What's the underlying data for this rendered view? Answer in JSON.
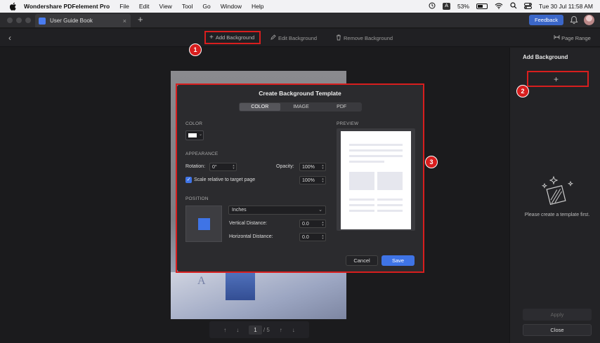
{
  "menubar": {
    "app_name": "Wondershare PDFelement Pro",
    "menus": [
      "File",
      "Edit",
      "View",
      "Tool",
      "Go",
      "Window",
      "Help"
    ],
    "input_source": "A",
    "battery": "53%",
    "battery_level": 0.53,
    "datetime": "Tue 30 Jul  11:58 AM"
  },
  "tabbar": {
    "doc_tab_label": "User Guide Book",
    "close_glyph": "×",
    "new_tab_glyph": "+",
    "feedback_label": "Feedback"
  },
  "toolbar": {
    "back_glyph": "‹",
    "add_background": "Add Background",
    "edit_background": "Edit Background",
    "remove_background": "Remove Background",
    "page_range": "Page Range"
  },
  "callouts": [
    "1",
    "2",
    "3"
  ],
  "pager": {
    "current_page": "1",
    "separator": "/",
    "total_pages": "5"
  },
  "right_panel": {
    "title": "Add Background",
    "add_template_glyph": "+",
    "empty_text": "Please create a template first.",
    "apply_label": "Apply",
    "close_label": "Close"
  },
  "dialog": {
    "title": "Create Background Template",
    "tabs": [
      "COLOR",
      "IMAGE",
      "PDF"
    ],
    "active_tab": "COLOR",
    "color_section": "COLOR",
    "selected_color": "#ffffff",
    "appearance_section": "APPEARANCE",
    "rotation_label": "Rotation:",
    "rotation_value": "0°",
    "opacity_label": "Opacity:",
    "opacity_value": "100%",
    "scale_label": "Scale relative to target page",
    "scale_checked": true,
    "scale_value": "100%",
    "position_section": "POSITION",
    "units_value": "Inches",
    "vertical_label": "Vertical Distance:",
    "vertical_value": "0.0",
    "horizontal_label": "Horizontal Distance:",
    "horizontal_value": "0.0",
    "preview_section": "PREVIEW",
    "cancel_label": "Cancel",
    "save_label": "Save"
  },
  "colors": {
    "accent": "#3f74e6",
    "callout_red": "#d81e1e",
    "feedback_blue": "#3b67c9"
  },
  "icons": [
    "apple-icon",
    "clock-icon",
    "wifi-icon",
    "search-icon",
    "control-center-icon",
    "bell-icon",
    "plus-icon",
    "edit-icon",
    "trash-icon",
    "page-range-icon",
    "sparkle-template-icon",
    "chevron-down-icon",
    "checkmark-icon"
  ]
}
